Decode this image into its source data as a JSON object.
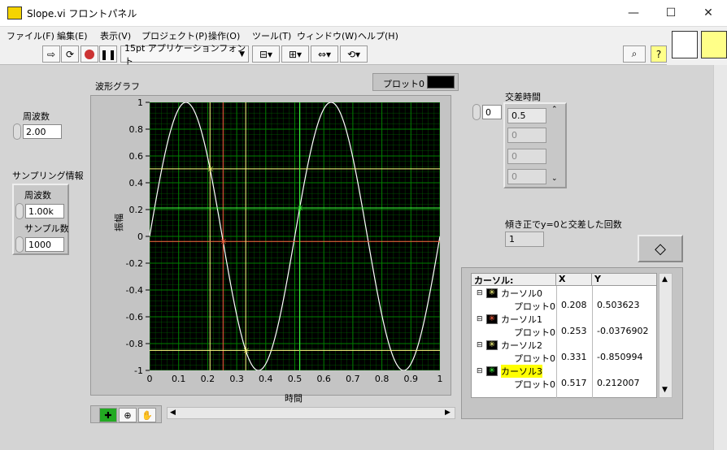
{
  "window": {
    "title": "Slope.vi フロントパネル",
    "min": "—",
    "max": "☐",
    "close": "✕"
  },
  "menu": [
    "ファイル(F)",
    "編集(E)",
    "表示(V)",
    "プロジェクト(P)",
    "操作(O)",
    "ツール(T)",
    "ウィンドウ(W)",
    "ヘルプ(H)"
  ],
  "toolbar": {
    "font": "15pt アプリケーションフォント",
    "font_arrow": "▼"
  },
  "frequency": {
    "label": "周波数",
    "value": "2.00"
  },
  "sampling": {
    "label": "サンプリング情報",
    "freq_label": "周波数",
    "freq_value": "1.00k",
    "samples_label": "サンプル数",
    "samples_value": "1000"
  },
  "graph": {
    "title": "波形グラフ",
    "legend": "プロット0",
    "xlabel": "時間",
    "ylabel": "振幅"
  },
  "crossing_time": {
    "label": "交差時間",
    "index": "0",
    "values": [
      "0.5",
      "0",
      "0",
      "0"
    ]
  },
  "count": {
    "label": "傾き正でy=0と交差した回数",
    "value": "1"
  },
  "cursor_table": {
    "headers": [
      "カーソル:",
      "X",
      "Y"
    ],
    "rows": [
      {
        "name": "カーソル0",
        "plot": "プロット0",
        "x": "0.208",
        "y": "0.503623",
        "color": "#ffff80"
      },
      {
        "name": "カーソル1",
        "plot": "プロット0",
        "x": "0.253",
        "y": "-0.0376902",
        "color": "#ff6040"
      },
      {
        "name": "カーソル2",
        "plot": "プロット0",
        "x": "0.331",
        "y": "-0.850994",
        "color": "#ffff80"
      },
      {
        "name": "カーソル3",
        "plot": "プロット0",
        "x": "0.517",
        "y": "0.212007",
        "color": "#40ff40"
      }
    ]
  },
  "chart_data": {
    "type": "line",
    "title": "波形グラフ",
    "xlabel": "時間",
    "ylabel": "振幅",
    "xlim": [
      0,
      1
    ],
    "ylim": [
      -1,
      1
    ],
    "xticks": [
      "0",
      "0.1",
      "0.2",
      "0.3",
      "0.4",
      "0.5",
      "0.6",
      "0.7",
      "0.8",
      "0.9",
      "1"
    ],
    "yticks": [
      "1",
      "0.8",
      "0.6",
      "0.4",
      "0.2",
      "0",
      "-0.2",
      "-0.4",
      "-0.6",
      "-0.8",
      "-1"
    ],
    "series": [
      {
        "name": "プロット0",
        "function": "sin(2π·2·t)",
        "frequency": 2,
        "samples": 1000
      }
    ],
    "cursors": [
      {
        "name": "カーソル0",
        "x": 0.208,
        "y": 0.503623,
        "color": "#ffff80"
      },
      {
        "name": "カーソル1",
        "x": 0.253,
        "y": -0.0376902,
        "color": "#ff6040"
      },
      {
        "name": "カーソル2",
        "x": 0.331,
        "y": -0.850994,
        "color": "#ffff80"
      },
      {
        "name": "カーソル3",
        "x": 0.517,
        "y": 0.212007,
        "color": "#40ff40"
      }
    ],
    "grid": true,
    "colors": {
      "background": "#000000",
      "grid": "#008000",
      "trace": "#ffffff"
    }
  }
}
